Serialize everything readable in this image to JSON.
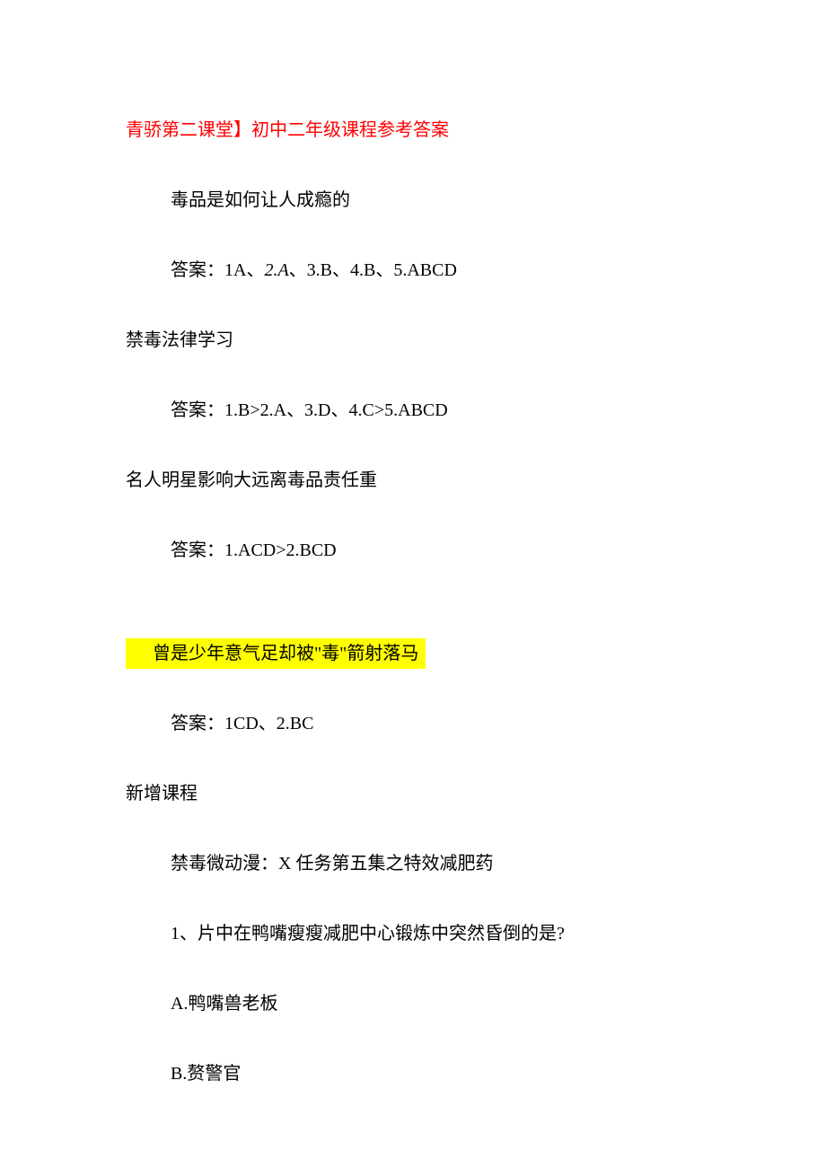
{
  "title": "青骄第二课堂】初中二年级课程参考答案",
  "sections": [
    {
      "heading": "毒品是如何让人成瘾的",
      "answer_prefix": "答案：",
      "answer_items": "1A、",
      "answer_italic": "2.A",
      "answer_rest": "、3.B、4.B、5.ABCD"
    },
    {
      "heading": "禁毒法律学习",
      "answer_prefix": "答案：",
      "answer_text": "1.B>2.A、3.D、4.C>5.ABCD"
    },
    {
      "heading": "名人明星影响大远离毒品责任重",
      "answer_prefix": "答案：",
      "answer_text": "1.ACD>2.BCD"
    }
  ],
  "highlighted": {
    "text": "曾是少年意气足却被\"毒\"箭射落马"
  },
  "highlighted_answer": {
    "prefix": "答案：",
    "text": "1CD、2.BC"
  },
  "new_courses_title": "新增课程",
  "course_name": "禁毒微动漫：X 任务第五集之特效减肥药",
  "question_1": "1、片中在鸭嘴瘦瘦减肥中心锻炼中突然昏倒的是?",
  "options": {
    "a": "A.鸭嘴兽老板",
    "b": "B.赘警官"
  }
}
